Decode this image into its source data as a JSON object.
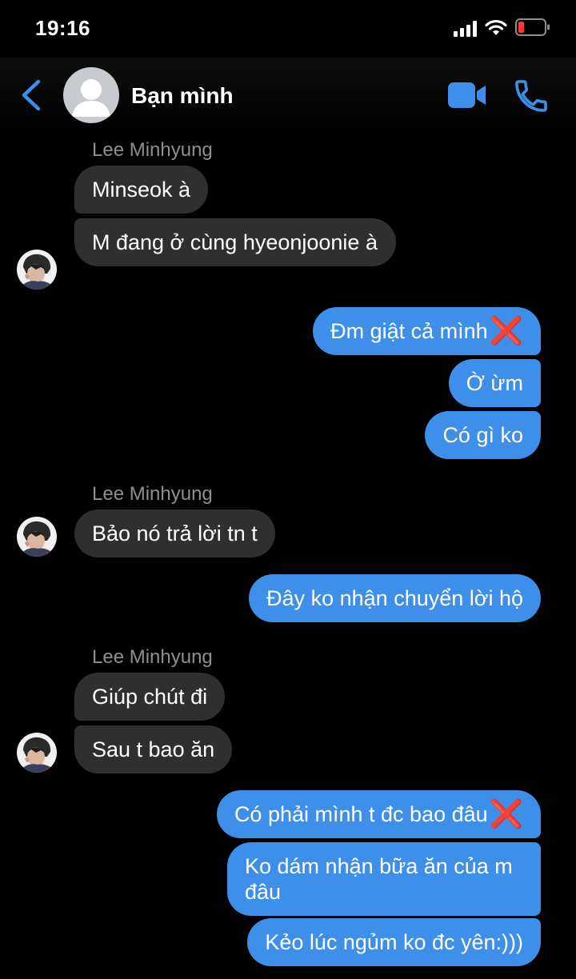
{
  "status": {
    "time": "19:16"
  },
  "header": {
    "contact_name": "Bạn mình"
  },
  "messages": {
    "s1": "Lee Minhyung",
    "m1": "Minseok à",
    "m2": "M đang ở cùng hyeonjoonie à",
    "m3": "Đm giật cả mình",
    "m4": "Ờ ừm",
    "m5": "Có gì ko",
    "s2": "Lee Minhyung",
    "m6": "Bảo nó trả lời tn t",
    "m7": "Đây ko nhận chuyển lời hộ",
    "s3": "Lee Minhyung",
    "m8": "Giúp chút đi",
    "m9": "Sau t bao ăn",
    "m10": "Có phải mình t đc bao đâu",
    "m11": "Ko dám nhận bữa ăn của m đâu",
    "m12": "Kẻo lúc ngủm ko đc yên:)))"
  },
  "emoji": {
    "cross": "❌"
  },
  "colors": {
    "accent": "#3e8fe9",
    "incoming_bubble": "#2f2f2f",
    "background": "#000000",
    "cross": "#e0232e"
  },
  "icons": [
    "back-chevron-icon",
    "video-call-icon",
    "phone-call-icon",
    "cellular-signal-icon",
    "wifi-icon",
    "battery-icon"
  ]
}
